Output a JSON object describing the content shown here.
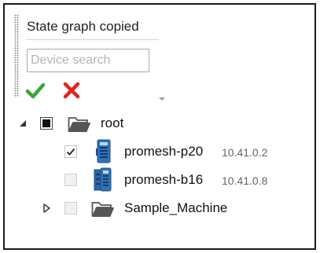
{
  "panel": {
    "title": "State graph copied",
    "search": {
      "placeholder": "Device search",
      "value": ""
    },
    "actions": [
      {
        "name": "confirm",
        "icon": "check-icon",
        "color": "#3aa53a"
      },
      {
        "name": "cancel",
        "icon": "x-icon",
        "color": "#e0261d"
      }
    ]
  },
  "tree": {
    "root": {
      "label": "root",
      "expanded": true,
      "checkbox": "partial",
      "icon": "folder-open-icon"
    },
    "devices": [
      {
        "label": "promesh-p20",
        "ip": "10.41.0.2",
        "checked": true,
        "icon": "network-switch-icon"
      },
      {
        "label": "promesh-b16",
        "ip": "10.41.0.8",
        "checked": false,
        "icon": "network-switch-icon"
      }
    ],
    "folders": [
      {
        "label": "Sample_Machine",
        "expanded": false,
        "checked": false,
        "icon": "folder-open-icon"
      }
    ]
  },
  "colors": {
    "switch_blue": "#2f73b5",
    "folder_gray": "#555555",
    "check_green": "#3aa53a",
    "cancel_red": "#e0261d"
  }
}
